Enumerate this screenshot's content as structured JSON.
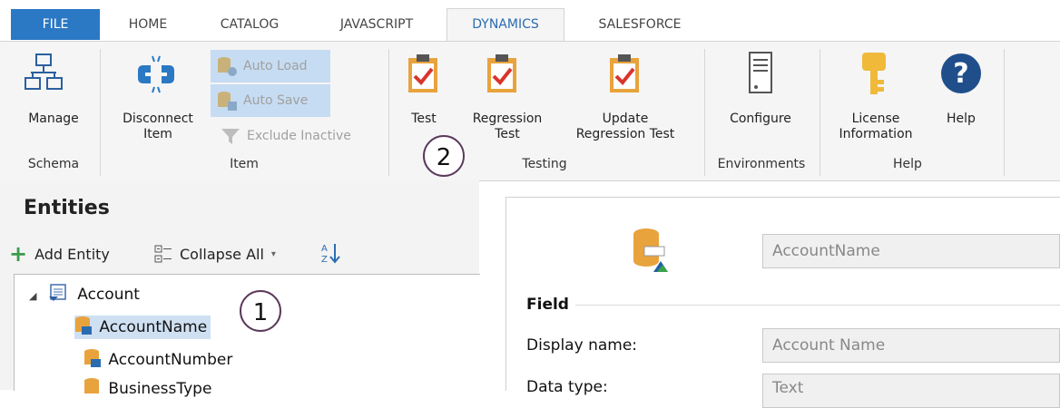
{
  "tabs": [
    {
      "label": "FILE"
    },
    {
      "label": "HOME"
    },
    {
      "label": "CATALOG"
    },
    {
      "label": "JAVASCRIPT"
    },
    {
      "label": "DYNAMICS"
    },
    {
      "label": "SALESFORCE"
    }
  ],
  "active_tab": "DYNAMICS",
  "ribbon": {
    "schema": {
      "manage": "Manage",
      "group": "Schema"
    },
    "item": {
      "disconnect": "Disconnect\nItem",
      "auto_load": "Auto Load",
      "auto_save": "Auto Save",
      "exclude_inactive": "Exclude Inactive",
      "group": "Item"
    },
    "testing": {
      "test": "Test",
      "regression_test": "Regression\nTest",
      "update_regression_test": "Update\nRegression Test",
      "group": "Testing"
    },
    "environments": {
      "configure": "Configure",
      "group": "Environments"
    },
    "help": {
      "license": "License\nInformation",
      "help": "Help",
      "group": "Help"
    }
  },
  "entities": {
    "title": "Entities",
    "add_entity": "Add Entity",
    "collapse_all": "Collapse All",
    "tree": [
      {
        "label": "Account",
        "level": 0
      },
      {
        "label": "AccountName",
        "level": 1,
        "selected": true
      },
      {
        "label": "AccountNumber",
        "level": 1
      },
      {
        "label": "BusinessType",
        "level": 1
      }
    ]
  },
  "details": {
    "name_value": "AccountName",
    "section": "Field",
    "display_name_label": "Display name:",
    "display_name_value": "Account Name",
    "data_type_label": "Data type:",
    "data_type_value": "Text"
  },
  "callouts": [
    "1",
    "2"
  ],
  "colors": {
    "file_tab": "#2b78c4",
    "accent": "#2b6cb0",
    "selection": "#cfe0f3"
  }
}
